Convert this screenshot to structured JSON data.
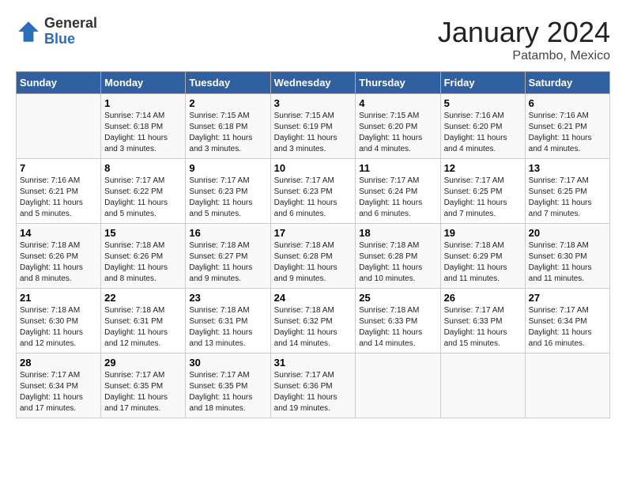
{
  "header": {
    "logo_general": "General",
    "logo_blue": "Blue",
    "title": "January 2024",
    "subtitle": "Patambo, Mexico"
  },
  "days_of_week": [
    "Sunday",
    "Monday",
    "Tuesday",
    "Wednesday",
    "Thursday",
    "Friday",
    "Saturday"
  ],
  "weeks": [
    [
      {
        "num": "",
        "info": ""
      },
      {
        "num": "1",
        "info": "Sunrise: 7:14 AM\nSunset: 6:18 PM\nDaylight: 11 hours\nand 3 minutes."
      },
      {
        "num": "2",
        "info": "Sunrise: 7:15 AM\nSunset: 6:18 PM\nDaylight: 11 hours\nand 3 minutes."
      },
      {
        "num": "3",
        "info": "Sunrise: 7:15 AM\nSunset: 6:19 PM\nDaylight: 11 hours\nand 3 minutes."
      },
      {
        "num": "4",
        "info": "Sunrise: 7:15 AM\nSunset: 6:20 PM\nDaylight: 11 hours\nand 4 minutes."
      },
      {
        "num": "5",
        "info": "Sunrise: 7:16 AM\nSunset: 6:20 PM\nDaylight: 11 hours\nand 4 minutes."
      },
      {
        "num": "6",
        "info": "Sunrise: 7:16 AM\nSunset: 6:21 PM\nDaylight: 11 hours\nand 4 minutes."
      }
    ],
    [
      {
        "num": "7",
        "info": "Sunrise: 7:16 AM\nSunset: 6:21 PM\nDaylight: 11 hours\nand 5 minutes."
      },
      {
        "num": "8",
        "info": "Sunrise: 7:17 AM\nSunset: 6:22 PM\nDaylight: 11 hours\nand 5 minutes."
      },
      {
        "num": "9",
        "info": "Sunrise: 7:17 AM\nSunset: 6:23 PM\nDaylight: 11 hours\nand 5 minutes."
      },
      {
        "num": "10",
        "info": "Sunrise: 7:17 AM\nSunset: 6:23 PM\nDaylight: 11 hours\nand 6 minutes."
      },
      {
        "num": "11",
        "info": "Sunrise: 7:17 AM\nSunset: 6:24 PM\nDaylight: 11 hours\nand 6 minutes."
      },
      {
        "num": "12",
        "info": "Sunrise: 7:17 AM\nSunset: 6:25 PM\nDaylight: 11 hours\nand 7 minutes."
      },
      {
        "num": "13",
        "info": "Sunrise: 7:17 AM\nSunset: 6:25 PM\nDaylight: 11 hours\nand 7 minutes."
      }
    ],
    [
      {
        "num": "14",
        "info": "Sunrise: 7:18 AM\nSunset: 6:26 PM\nDaylight: 11 hours\nand 8 minutes."
      },
      {
        "num": "15",
        "info": "Sunrise: 7:18 AM\nSunset: 6:26 PM\nDaylight: 11 hours\nand 8 minutes."
      },
      {
        "num": "16",
        "info": "Sunrise: 7:18 AM\nSunset: 6:27 PM\nDaylight: 11 hours\nand 9 minutes."
      },
      {
        "num": "17",
        "info": "Sunrise: 7:18 AM\nSunset: 6:28 PM\nDaylight: 11 hours\nand 9 minutes."
      },
      {
        "num": "18",
        "info": "Sunrise: 7:18 AM\nSunset: 6:28 PM\nDaylight: 11 hours\nand 10 minutes."
      },
      {
        "num": "19",
        "info": "Sunrise: 7:18 AM\nSunset: 6:29 PM\nDaylight: 11 hours\nand 11 minutes."
      },
      {
        "num": "20",
        "info": "Sunrise: 7:18 AM\nSunset: 6:30 PM\nDaylight: 11 hours\nand 11 minutes."
      }
    ],
    [
      {
        "num": "21",
        "info": "Sunrise: 7:18 AM\nSunset: 6:30 PM\nDaylight: 11 hours\nand 12 minutes."
      },
      {
        "num": "22",
        "info": "Sunrise: 7:18 AM\nSunset: 6:31 PM\nDaylight: 11 hours\nand 12 minutes."
      },
      {
        "num": "23",
        "info": "Sunrise: 7:18 AM\nSunset: 6:31 PM\nDaylight: 11 hours\nand 13 minutes."
      },
      {
        "num": "24",
        "info": "Sunrise: 7:18 AM\nSunset: 6:32 PM\nDaylight: 11 hours\nand 14 minutes."
      },
      {
        "num": "25",
        "info": "Sunrise: 7:18 AM\nSunset: 6:33 PM\nDaylight: 11 hours\nand 14 minutes."
      },
      {
        "num": "26",
        "info": "Sunrise: 7:17 AM\nSunset: 6:33 PM\nDaylight: 11 hours\nand 15 minutes."
      },
      {
        "num": "27",
        "info": "Sunrise: 7:17 AM\nSunset: 6:34 PM\nDaylight: 11 hours\nand 16 minutes."
      }
    ],
    [
      {
        "num": "28",
        "info": "Sunrise: 7:17 AM\nSunset: 6:34 PM\nDaylight: 11 hours\nand 17 minutes."
      },
      {
        "num": "29",
        "info": "Sunrise: 7:17 AM\nSunset: 6:35 PM\nDaylight: 11 hours\nand 17 minutes."
      },
      {
        "num": "30",
        "info": "Sunrise: 7:17 AM\nSunset: 6:35 PM\nDaylight: 11 hours\nand 18 minutes."
      },
      {
        "num": "31",
        "info": "Sunrise: 7:17 AM\nSunset: 6:36 PM\nDaylight: 11 hours\nand 19 minutes."
      },
      {
        "num": "",
        "info": ""
      },
      {
        "num": "",
        "info": ""
      },
      {
        "num": "",
        "info": ""
      }
    ]
  ]
}
